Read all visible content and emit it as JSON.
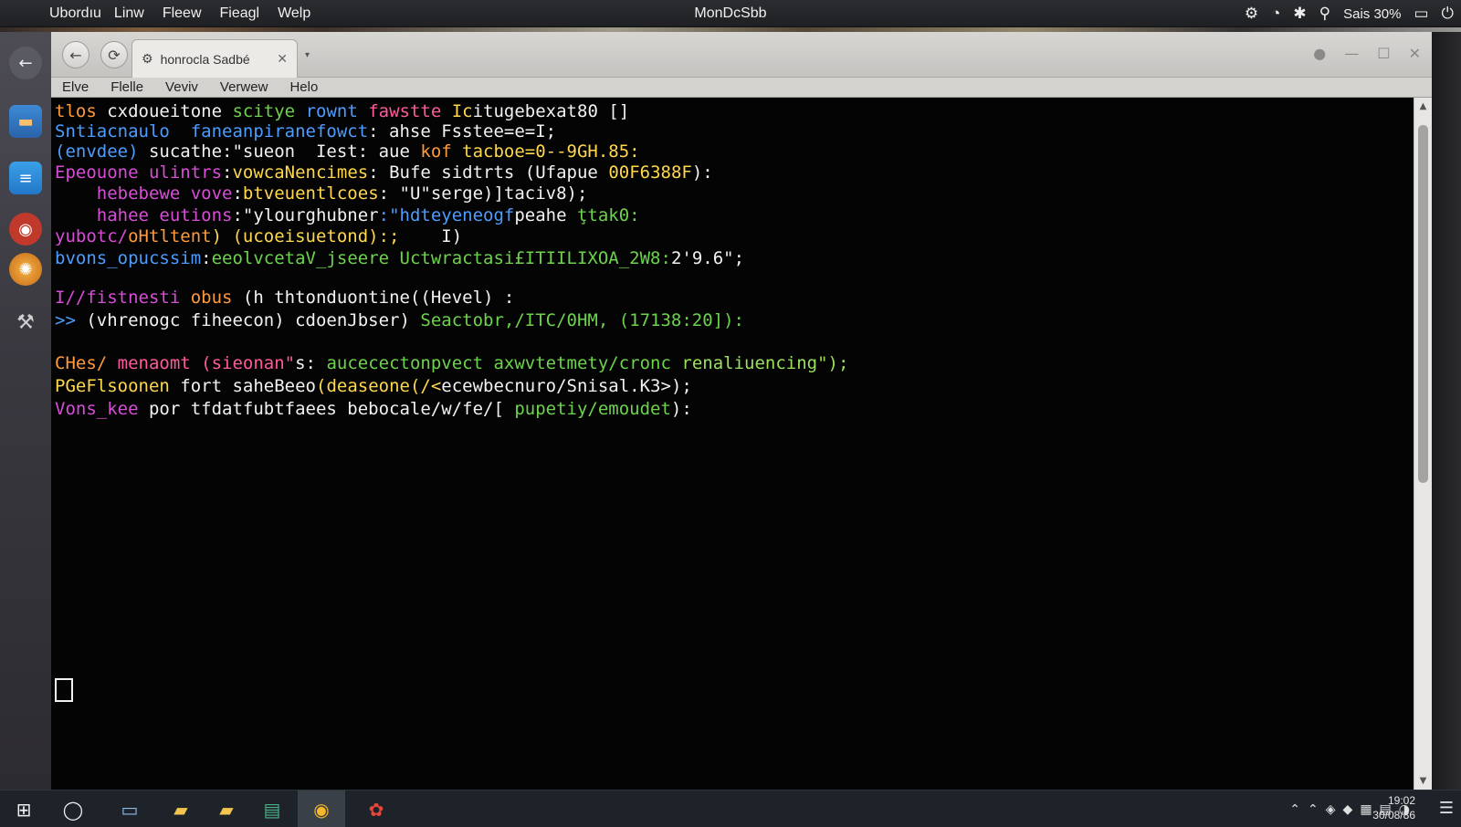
{
  "system_bar": {
    "apple_icon": "apple-icon",
    "menus": [
      "Ubordıu",
      "Linw",
      "Fleew",
      "Fieagl",
      "Welp"
    ],
    "center_title": "MonDcSbb",
    "status_text": "Sais 30%",
    "tray_icons": [
      "gear-icon",
      "clock-icon",
      "bluetooth-icon",
      "search-icon",
      "display-icon",
      "power-icon"
    ]
  },
  "dock": {
    "items": [
      "back-icon",
      "files-icon",
      "document-icon",
      "media-icon",
      "browser-icon",
      "settings-icon"
    ]
  },
  "window": {
    "tab_title": "honrocla Sadbé",
    "menus": [
      "Elve",
      "Flelle",
      "Veviv",
      "Verwew",
      "Helo"
    ]
  },
  "terminal": {
    "colors": {
      "orange": "#ff9a3d",
      "white": "#f2f2f2",
      "blue": "#4d9dff",
      "green": "#6dd34c",
      "yellow": "#ffd84d",
      "magenta": "#d84dd8",
      "pink": "#ff5a9b",
      "cyan": "#4fd0e8",
      "lime": "#9be15d"
    },
    "lines": [
      [
        {
          "t": "tlos ",
          "c": "orange"
        },
        {
          "t": "cxdoueitone ",
          "c": "white"
        },
        {
          "t": "scitye ",
          "c": "green"
        },
        {
          "t": "rownt ",
          "c": "blue"
        },
        {
          "t": "fawstte ",
          "c": "pink"
        },
        {
          "t": "Ic",
          "c": "yellow"
        },
        {
          "t": "itugebexat80 []",
          "c": "white"
        }
      ],
      [
        {
          "t": "Sntiacnaulo  faneanpiranefowct",
          "c": "blue"
        },
        {
          "t": ": ahse Fsstee=e=I;",
          "c": "white"
        }
      ],
      [
        {
          "t": "(envdee) ",
          "c": "blue"
        },
        {
          "t": "sucathe:\"sueon  ",
          "c": "white"
        },
        {
          "t": "Iest: aue ",
          "c": "white"
        },
        {
          "t": "kof ",
          "c": "orange"
        },
        {
          "t": "tacboe=0--9GH.85:",
          "c": "yellow"
        }
      ],
      [
        {
          "t": "Epeouone ulintrs",
          "c": "magenta"
        },
        {
          "t": ":",
          "c": "white"
        },
        {
          "t": "vowcaNencimes",
          "c": "yellow"
        },
        {
          "t": ": Bufe sidtrts (Ufapue ",
          "c": "white"
        },
        {
          "t": "00F6388F",
          "c": "yellow"
        },
        {
          "t": "):",
          "c": "white"
        }
      ],
      [
        {
          "t": "    hebebewe vove",
          "c": "magenta"
        },
        {
          "t": ":",
          "c": "white"
        },
        {
          "t": "btveuentlcoes",
          "c": "yellow"
        },
        {
          "t": ": \"U\"serge)]taciv8);",
          "c": "white"
        }
      ],
      [
        {
          "t": "    hahee eutions",
          "c": "magenta"
        },
        {
          "t": ":\"ylourghubner",
          "c": "white"
        },
        {
          "t": ":\"hdteyeneogf",
          "c": "blue"
        },
        {
          "t": "peahe ",
          "c": "white"
        },
        {
          "t": "ţtak0:",
          "c": "green"
        }
      ],
      [
        {
          "t": "yubotc/",
          "c": "magenta"
        },
        {
          "t": "oHtltent",
          "c": "orange"
        },
        {
          "t": ") (ucoeisuetond):;    ",
          "c": "yellow"
        },
        {
          "t": "I)",
          "c": "white"
        }
      ],
      [
        {
          "t": "bvons_opucssim",
          "c": "blue"
        },
        {
          "t": ":",
          "c": "white"
        },
        {
          "t": "eeolvcetaV_jseere ",
          "c": "green"
        },
        {
          "t": "Uctwractasi£ITIILIXOA_2W8:",
          "c": "green"
        },
        {
          "t": "2'9.6\";",
          "c": "white"
        }
      ],
      [
        {
          "t": "I//fistnesti ",
          "c": "magenta"
        },
        {
          "t": "obus ",
          "c": "orange"
        },
        {
          "t": "(h thtonduontine((Hevel) :",
          "c": "white"
        }
      ],
      [
        {
          "t": ">> ",
          "c": "blue"
        },
        {
          "t": "(vhrenogc fiheecon) cdoenJbser) ",
          "c": "white"
        },
        {
          "t": "Seactobr,/ITC/0HM, (17138:20]):",
          "c": "green"
        }
      ],
      [
        {
          "t": "CHes/ ",
          "c": "orange"
        },
        {
          "t": "menaomt (sieonan\"",
          "c": "pink"
        },
        {
          "t": "s: ",
          "c": "white"
        },
        {
          "t": "aucecectonpvect axwvtetmety/cronc ",
          "c": "green"
        },
        {
          "t": "renaliuencing\");",
          "c": "lime"
        }
      ],
      [
        {
          "t": "PGeFlsoonen ",
          "c": "yellow"
        },
        {
          "t": "fort saheBeeo",
          "c": "white"
        },
        {
          "t": "(deaseone(/<",
          "c": "yellow"
        },
        {
          "t": "ecewbecnuro/Snisal.K3>);",
          "c": "white"
        }
      ],
      [
        {
          "t": "Vons_kee ",
          "c": "magenta"
        },
        {
          "t": "por tfdatfubtfaees ",
          "c": "white"
        },
        {
          "t": "bebocale/w/fe/[ ",
          "c": "white"
        },
        {
          "t": "pupetiy/emoudet",
          "c": "green"
        },
        {
          "t": "):",
          "c": "white"
        }
      ]
    ]
  },
  "taskbar": {
    "apps": [
      "windows-start-icon",
      "search-icon",
      "explorer-icon",
      "folder-icon",
      "folder-icon",
      "store-icon",
      "chrome-icon",
      "app-icon"
    ],
    "clock_time": "19:02",
    "clock_date": "30/08/86"
  }
}
